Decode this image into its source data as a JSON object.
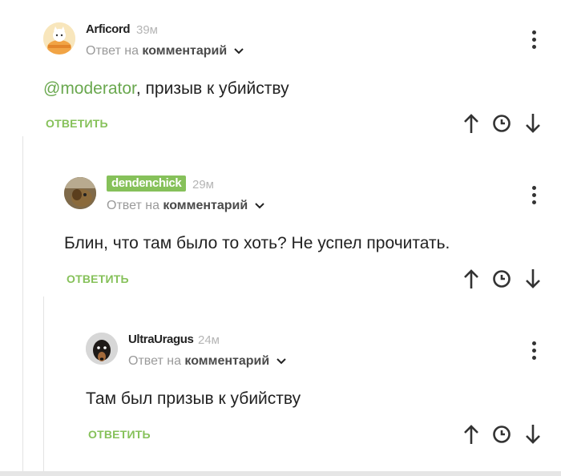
{
  "comments": [
    {
      "author": "Arficord",
      "time": "39м",
      "reply_prefix": "Ответ на",
      "reply_target": "комментарий",
      "mention": "@moderator",
      "text": ", призыв к убийству",
      "reply_label": "ОТВЕТИТЬ",
      "avatar_icon": "cat-cartoon-avatar"
    },
    {
      "author": "dendenchick",
      "time": "29м",
      "reply_prefix": "Ответ на",
      "reply_target": "комментарий",
      "text": "Блин, что там было то хоть? Не успел прочитать.",
      "reply_label": "ОТВЕТИТЬ",
      "avatar_icon": "dog-photo-avatar",
      "badge_color": "#86c15a"
    },
    {
      "author": "UltraUragus",
      "time": "24м",
      "reply_prefix": "Ответ на",
      "reply_target": "комментарий",
      "text": "Там был призыв к убийству",
      "reply_label": "ОТВЕТИТЬ",
      "avatar_icon": "dachshund-photo-avatar"
    }
  ],
  "colors": {
    "accent": "#86c15a",
    "mention": "#6aa84f",
    "muted": "#9a9a9a"
  }
}
